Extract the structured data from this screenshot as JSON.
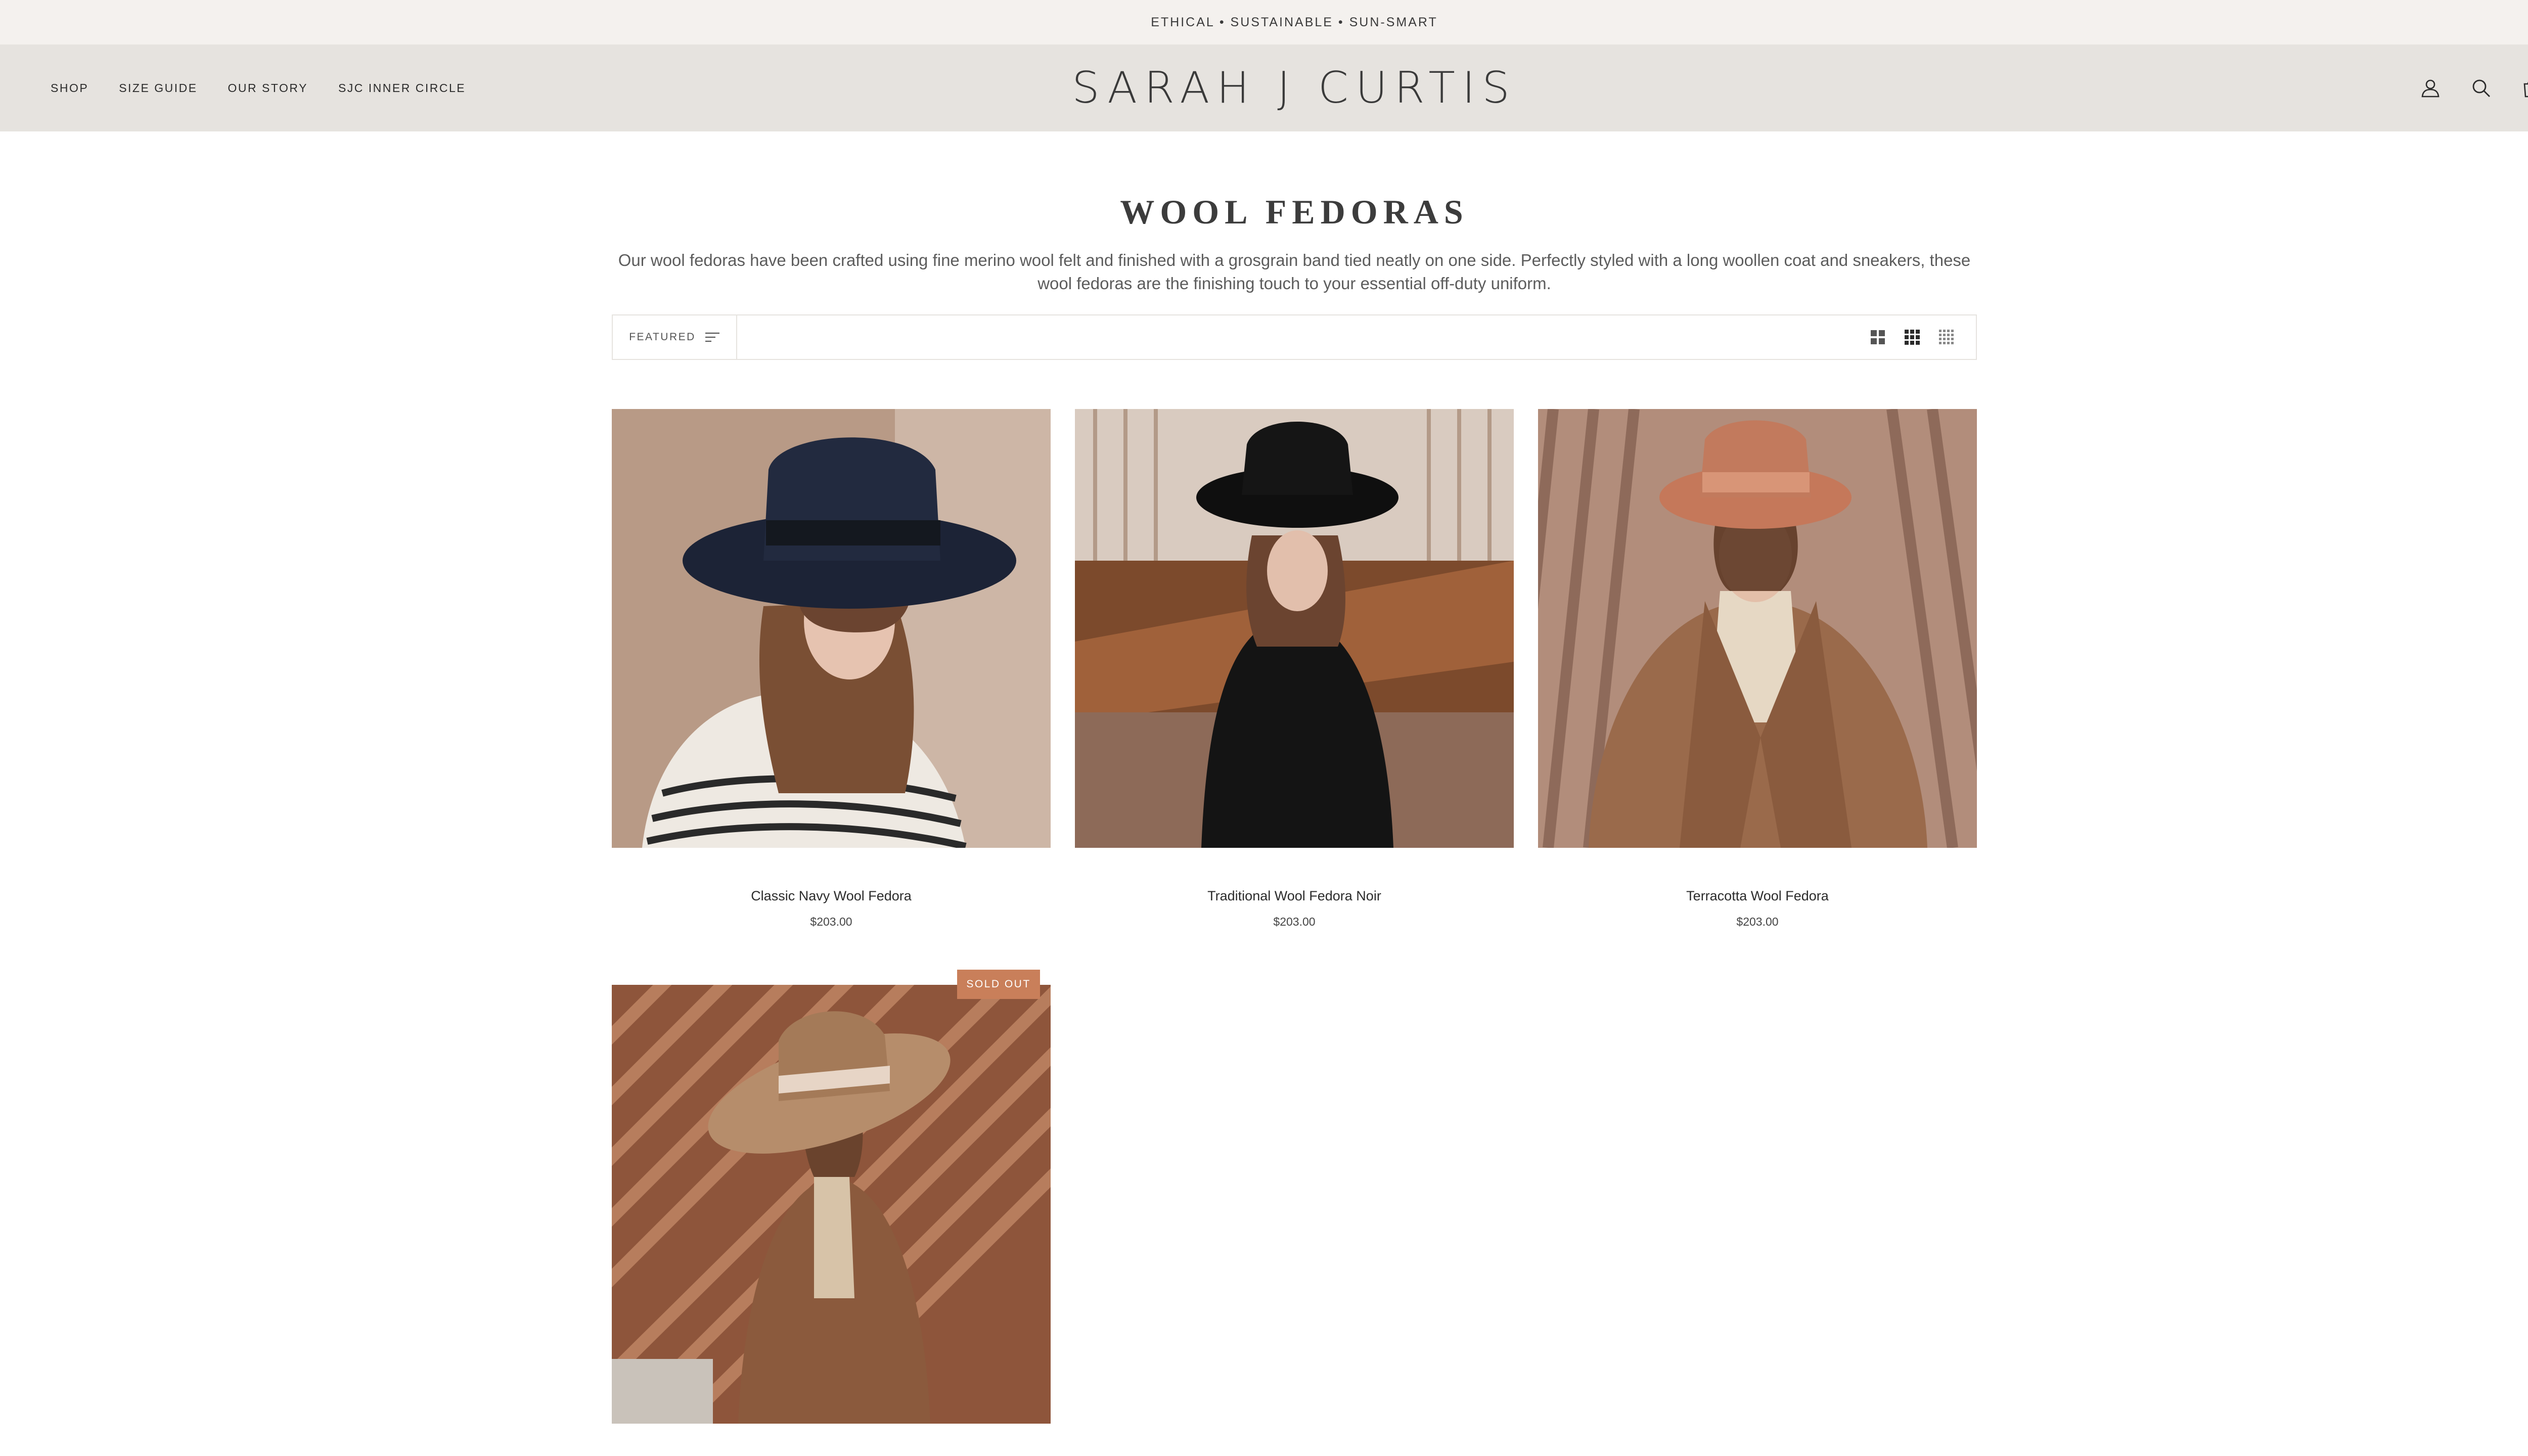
{
  "announcement": "ETHICAL • SUSTAINABLE • SUN-SMART",
  "header": {
    "nav": [
      "SHOP",
      "SIZE GUIDE",
      "OUR STORY",
      "SJC INNER CIRCLE"
    ],
    "logo": "SARAH J CURTIS",
    "icons": [
      "account-icon",
      "search-icon",
      "cart-icon"
    ]
  },
  "collection": {
    "title": "WOOL FEDORAS",
    "description": "Our wool fedoras have been crafted using fine merino wool felt and finished with a grosgrain band tied neatly on one side. Perfectly styled with a long woollen coat and sneakers, these wool fedoras are the finishing touch to your essential off-duty uniform."
  },
  "toolbar": {
    "sort_label": "FEATURED",
    "grid_icons": [
      "grid-large-icon",
      "grid-medium-icon",
      "grid-small-icon"
    ]
  },
  "products": [
    {
      "name": "Classic Navy Wool Fedora",
      "price": "$203.00"
    },
    {
      "name": "Traditional Wool Fedora Noir",
      "price": "$203.00"
    },
    {
      "name": "Terracotta Wool Fedora",
      "price": "$203.00"
    },
    {
      "name": "",
      "price": "",
      "badge": "SOLD OUT"
    }
  ],
  "colors": {
    "announcement_bg": "#f4f1ee",
    "header_bg": "#e6e3df",
    "badge_bg": "#c97f5a"
  }
}
